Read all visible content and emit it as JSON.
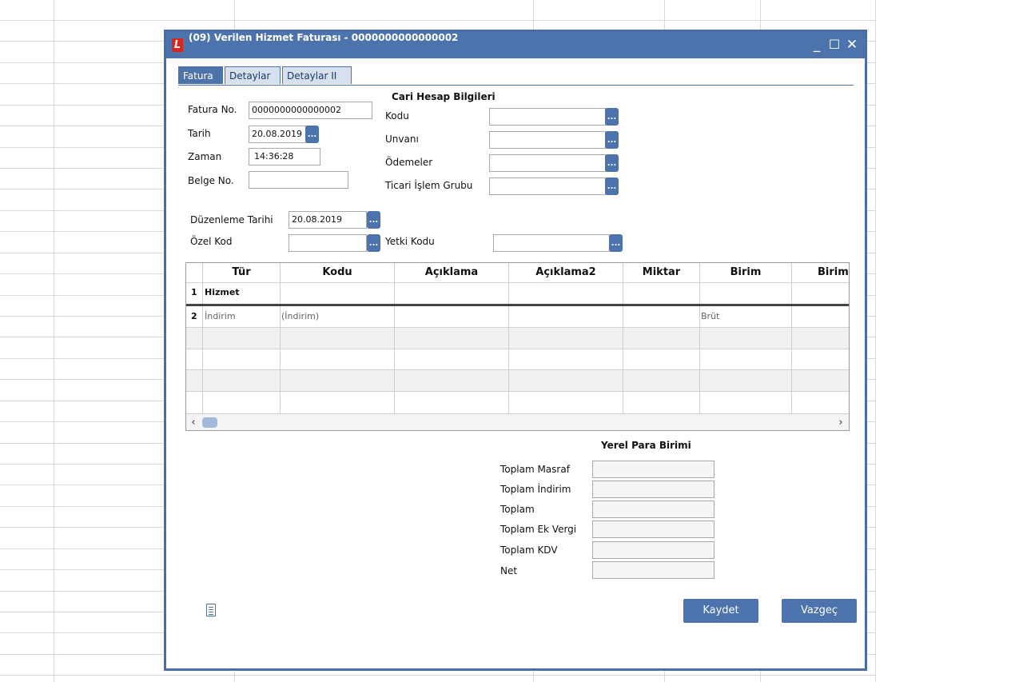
{
  "window": {
    "title": "(09) Verilen Hizmet Faturası - 0000000000000002",
    "logo": "L",
    "controls": {
      "minimize": "_",
      "maximize": "☐",
      "close": "✕"
    }
  },
  "tabs": [
    {
      "label": "Fatura",
      "active": true
    },
    {
      "label": "Detaylar",
      "active": false
    },
    {
      "label": "Detaylar II",
      "active": false
    }
  ],
  "invoice": {
    "fatura_no_label": "Fatura No.",
    "fatura_no_value": "0000000000000002",
    "tarih_label": "Tarih",
    "tarih_value": "20.08.2019",
    "zaman_label": "Zaman",
    "zaman_value": "14:36:28",
    "belge_no_label": "Belge No.",
    "belge_no_value": ""
  },
  "cari": {
    "heading": "Cari Hesap Bilgileri",
    "kodu_label": "Kodu",
    "unvani_label": "Unvanı",
    "odemeler_label": "Ödemeler",
    "ticari_label": "Ticari İşlem Grubu"
  },
  "extra": {
    "duzenleme_label": "Düzenleme Tarihi",
    "duzenleme_value": "20.08.2019",
    "ozel_kod_label": "Özel Kod",
    "yetki_kodu_label": "Yetki Kodu"
  },
  "dots_label": "...",
  "grid": {
    "columns": [
      "Tür",
      "Kodu",
      "Açıklama",
      "Açıklama2",
      "Miktar",
      "Birim",
      "Birim"
    ],
    "rows": [
      {
        "no": "1",
        "tur": "Hizmet",
        "kodu": "",
        "birim": ""
      },
      {
        "no": "2",
        "tur": "İndirim",
        "kodu": "(İndirim)",
        "birim": "Brüt"
      }
    ],
    "scroll_left": "‹",
    "scroll_right": "›"
  },
  "totals": {
    "heading": "Yerel Para Birimi",
    "masraf_label": "Toplam Masraf",
    "indirim_label": "Toplam İndirim",
    "toplam_label": "Toplam",
    "ek_vergi_label": "Toplam Ek Vergi",
    "kdv_label": "Toplam KDV",
    "net_label": "Net"
  },
  "buttons": {
    "kaydet": "Kaydet",
    "vazgec": "Vazgeç"
  },
  "colors": {
    "accent": "#4d73ad",
    "title_bar": "#4d73ad",
    "logo": "#d9261c"
  }
}
